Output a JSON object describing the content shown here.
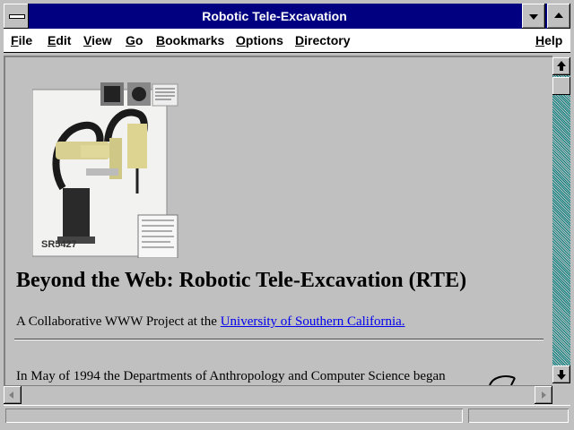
{
  "window": {
    "title": "Robotic Tele-Excavation"
  },
  "menu": {
    "file": "File",
    "edit": "Edit",
    "view": "View",
    "go": "Go",
    "bookmarks": "Bookmarks",
    "options": "Options",
    "directory": "Directory",
    "help": "Help"
  },
  "page": {
    "heading": "Beyond the Web: Robotic Tele-Excavation (RTE)",
    "collab_prefix": "A Collaborative WWW Project at the ",
    "collab_link": "University of Southern California. ",
    "paragraph": "In May of 1994 the Departments of Anthropology and Computer Science began",
    "robot_label": "SR5427"
  },
  "colors": {
    "titlebar": "#000080",
    "link": "#0000ee",
    "scroll_track": "#008080"
  }
}
